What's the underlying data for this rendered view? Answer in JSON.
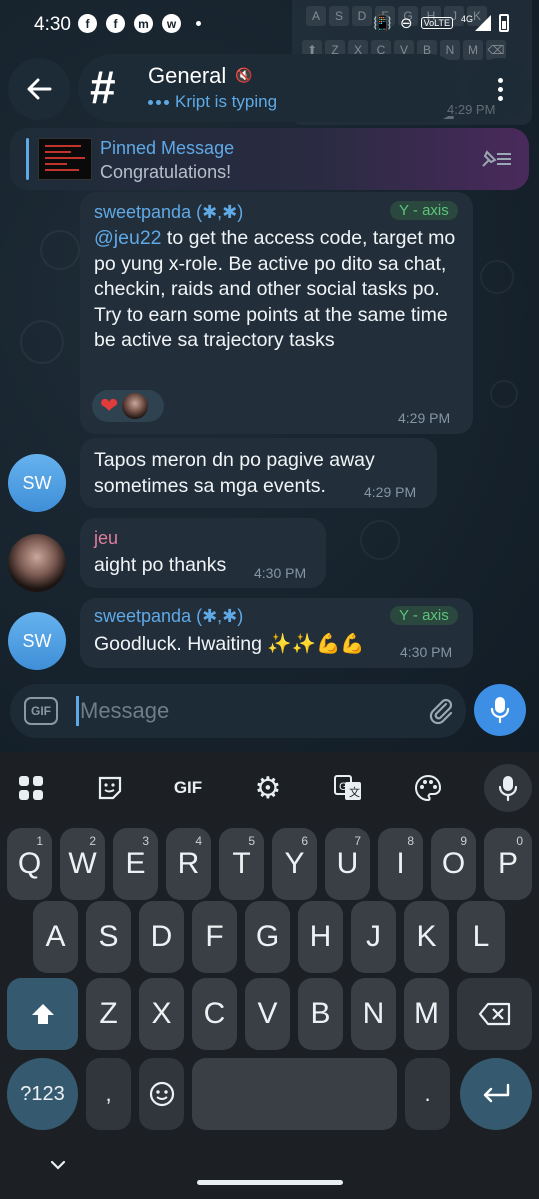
{
  "status_bar": {
    "time": "4:30",
    "app_icons": [
      "f",
      "f",
      "m",
      "w"
    ],
    "volte": "VoLTE",
    "network": "4G"
  },
  "ghost_keyboard": {
    "row1": [
      "A",
      "S",
      "D",
      "F",
      "G",
      "H",
      "J",
      "K"
    ],
    "row2": [
      "Z",
      "X",
      "C",
      "V",
      "B",
      "N",
      "M"
    ]
  },
  "ghost_time": "4:29 PM",
  "header": {
    "title": "General",
    "subtitle": "Kript is typing"
  },
  "pinned": {
    "title": "Pinned Message",
    "text": "Congratulations!"
  },
  "messages": [
    {
      "sender": "sweetpanda (✱,✱)",
      "tag": "Y - axis",
      "mention": "@jeu22",
      "text": " to get the access code, target mo po yung x-role. Be active po dito sa chat, checkin, raids and other social tasks po. Try to earn some points at the same time be active sa trajectory tasks",
      "time": "4:29 PM",
      "reaction": "❤"
    },
    {
      "avatar": "SW",
      "text": "Tapos meron dn po pagive away sometimes sa mga events.",
      "time": "4:29 PM"
    },
    {
      "sender": "jeu",
      "text": "aight po thanks",
      "time": "4:30 PM"
    },
    {
      "avatar": "SW",
      "sender": "sweetpanda (✱,✱)",
      "tag": "Y - axis",
      "text": "Goodluck. Hwaiting ✨✨💪💪",
      "time": "4:30 PM"
    }
  ],
  "input": {
    "gif_label": "GIF",
    "placeholder": "Message"
  },
  "keyboard": {
    "toolbar_gif": "GIF",
    "row1": [
      {
        "k": "Q",
        "h": "1"
      },
      {
        "k": "W",
        "h": "2"
      },
      {
        "k": "E",
        "h": "3"
      },
      {
        "k": "R",
        "h": "4"
      },
      {
        "k": "T",
        "h": "5"
      },
      {
        "k": "Y",
        "h": "6"
      },
      {
        "k": "U",
        "h": "7"
      },
      {
        "k": "I",
        "h": "8"
      },
      {
        "k": "O",
        "h": "9"
      },
      {
        "k": "P",
        "h": "0"
      }
    ],
    "row2": [
      "A",
      "S",
      "D",
      "F",
      "G",
      "H",
      "J",
      "K",
      "L"
    ],
    "row3": [
      "Z",
      "X",
      "C",
      "V",
      "B",
      "N",
      "M"
    ],
    "sym": "?123",
    "comma": ",",
    "period": "."
  },
  "colors": {
    "accent": "#5fa9e6",
    "bubble": "#222f3a",
    "tag_green": "#5cc47a",
    "mic_blue": "#3d8fe6",
    "pink_name": "#e07d9c"
  }
}
